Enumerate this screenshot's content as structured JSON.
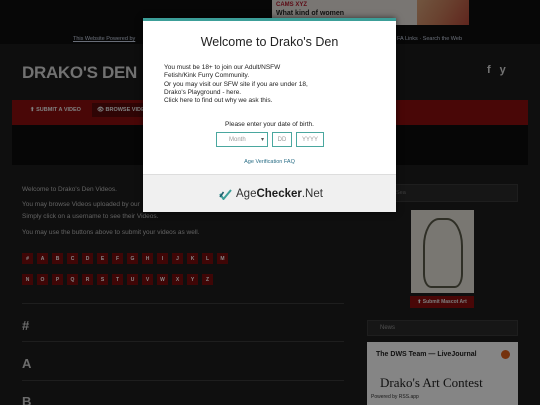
{
  "ad": {
    "brand": "CAMS XYZ",
    "text": "What kind of women"
  },
  "links": {
    "left": "This Website Powered by",
    "right": "FA Links · Search the Web"
  },
  "site": {
    "logo": "DRAKO'S DEN",
    "social": [
      "f",
      "y"
    ]
  },
  "nav": {
    "submit": "⬆ SUBMIT A VIDEO",
    "browse": "👁 BROWSE VIDEOS"
  },
  "content": {
    "welcome": "Welcome to Drako's Den Videos.",
    "browse_line": "You may browse Videos uploaded by our",
    "click_line": "Simply click on a username to see their Videos.",
    "buttons_line": "You may use the buttons above to submit your videos as well.",
    "letters_row1": [
      "#",
      "A",
      "B",
      "C",
      "D",
      "E",
      "F",
      "G",
      "H",
      "I",
      "J",
      "K",
      "L",
      "M"
    ],
    "letters_row2": [
      "N",
      "O",
      "P",
      "Q",
      "R",
      "S",
      "T",
      "U",
      "V",
      "W",
      "X",
      "Y",
      "Z"
    ],
    "sections": [
      "#",
      "A",
      "B"
    ]
  },
  "sidebar": {
    "search_label": "Sea",
    "mascot_button": "⬆ Submit Mascot Art",
    "news_label": "News",
    "card_title": "The DWS Team — LiveJournal",
    "card_heading": "Drako's Art Contest",
    "powered": "Powered by RSS.app"
  },
  "modal": {
    "title": "Welcome to Drako's Den",
    "body_lines": [
      "You must be 18+ to join our Adult/NSFW",
      "Fetish/Kink Furry Community.",
      "Or you may visit our SFW site if you are under 18,",
      "Drako's Playground - here.",
      "Click here to find out why we ask this."
    ],
    "prompt": "Please enter your date of birth.",
    "month_placeholder": "Month",
    "day_placeholder": "DD",
    "year_placeholder": "YYYY",
    "faq_link": "Age Verification FAQ",
    "brand_prefix": "Age",
    "brand_bold": "Checker",
    "brand_suffix": ".Net"
  },
  "colors": {
    "accent_teal": "#3c9e98",
    "nav_red": "#8c0f0f"
  }
}
